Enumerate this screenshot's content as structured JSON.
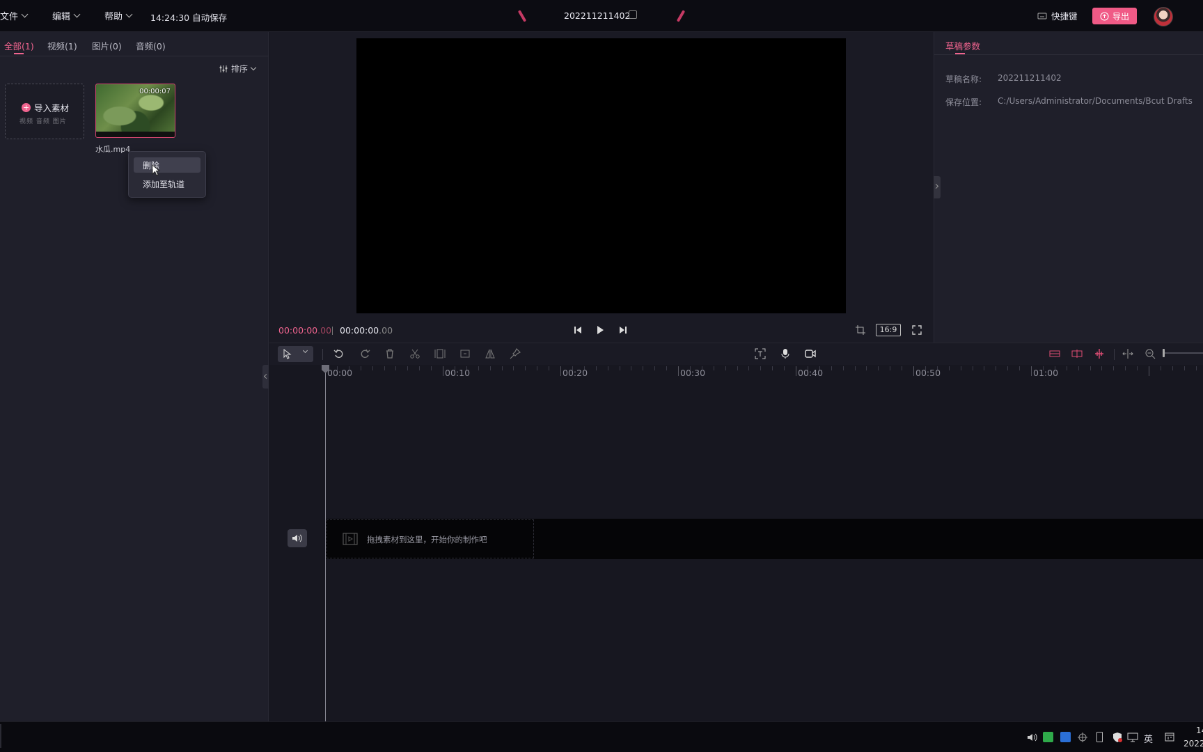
{
  "topbar": {
    "menus": [
      "文件",
      "编辑",
      "帮助"
    ],
    "autosave": "14:24:30 自动保存",
    "project_title": "202211211402",
    "shortcut_label": "快捷键",
    "export_label": "导出"
  },
  "media": {
    "tabs": [
      "全部(1)",
      "视频(1)",
      "图片(0)",
      "音频(0)"
    ],
    "sort_label": "排序",
    "import_label": "导入素材",
    "import_sub": "视频 音频 图片",
    "clip_duration": "00:00:07",
    "clip_name": "水瓜.mp4",
    "context_menu": [
      "删除",
      "添加至轨道"
    ]
  },
  "preview": {
    "current_time": "00:00:00",
    "current_frames": ".00",
    "total_time": "00:00:00",
    "total_frames": ".00",
    "ratio": "16:9"
  },
  "draft": {
    "tab_label": "草稿参数",
    "name_label": "草稿名称:",
    "name_value": "202211211402",
    "path_label": "保存位置:",
    "path_value": "C:/Users/Administrator/Documents/Bcut Drafts"
  },
  "timeline": {
    "labels": [
      "00:00",
      "00:10",
      "00:20",
      "00:30",
      "00:40",
      "00:50",
      "01:00"
    ],
    "drop_hint": "拖拽素材到这里，开始你的制作吧"
  },
  "taskbar": {
    "ime": "英",
    "clock_partial": "14",
    "date_partial": "2022"
  }
}
